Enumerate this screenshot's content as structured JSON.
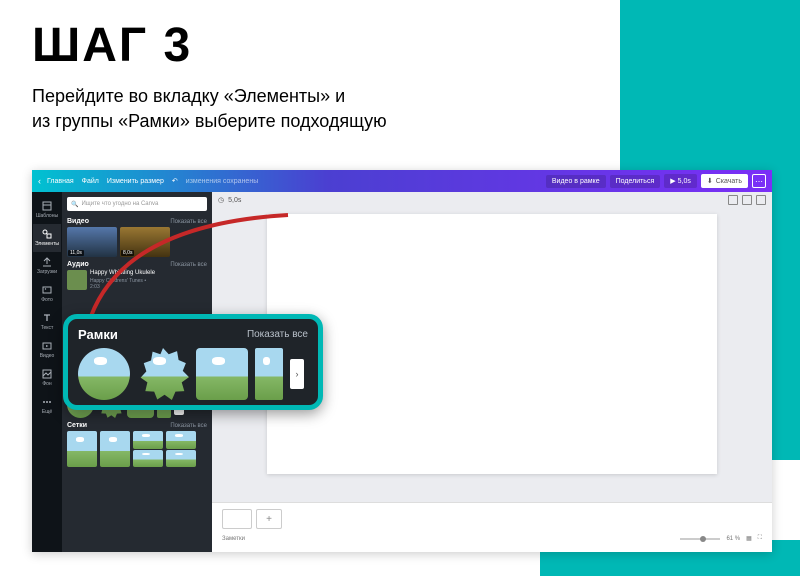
{
  "title": "ШАГ 3",
  "desc_line1": "Перейдите во вкладку «Элементы» и",
  "desc_line2": "из группы «Рамки» выберите подходящую",
  "topbar": {
    "back": "‹",
    "home": "Главная",
    "file": "Файл",
    "resize": "Изменить размер",
    "undo": "↶",
    "faded": "изменения сохранены",
    "video_frame": "Видео в рамке",
    "share": "Поделиться",
    "play": "▶",
    "play_time": "5,0s",
    "download": "Скачать",
    "download_icon": "⬇",
    "more": "⋯"
  },
  "rail": [
    {
      "icon": "template",
      "label": "Шаблоны"
    },
    {
      "icon": "elements",
      "label": "Элементы"
    },
    {
      "icon": "uploads",
      "label": "Загрузки"
    },
    {
      "icon": "photo",
      "label": "Фото"
    },
    {
      "icon": "text",
      "label": "Текст"
    },
    {
      "icon": "video",
      "label": "Видео"
    },
    {
      "icon": "bg",
      "label": "Фон"
    },
    {
      "icon": "more",
      "label": "Ещё"
    }
  ],
  "search": {
    "placeholder": "Ищите что угодно на Canva",
    "icon": "🔍"
  },
  "sections": {
    "video": {
      "title": "Видео",
      "all": "Показать все",
      "d1": "11,0s",
      "d2": "8,0s"
    },
    "audio": {
      "title": "Аудио",
      "all": "Показать все",
      "track": "Happy Whistling Ukulele",
      "sub1": "Happy Childrens' Tunes •",
      "sub2": "2:03"
    },
    "frames": {
      "title": "Рамки",
      "all": "Показать все"
    },
    "frames2": {
      "title": "Рамки",
      "all": "Показать все"
    },
    "grids": {
      "title": "Сетки",
      "all": "Показать все"
    }
  },
  "canvas_bar": {
    "timer_icon": "◷",
    "time": "5,0s"
  },
  "timeline": {
    "plus": "+",
    "notes": "Заметки",
    "zoom": "61 %",
    "grid": "▦",
    "full": "⛶"
  },
  "callout": {
    "title": "Рамки",
    "all": "Показать все",
    "next": "›"
  }
}
